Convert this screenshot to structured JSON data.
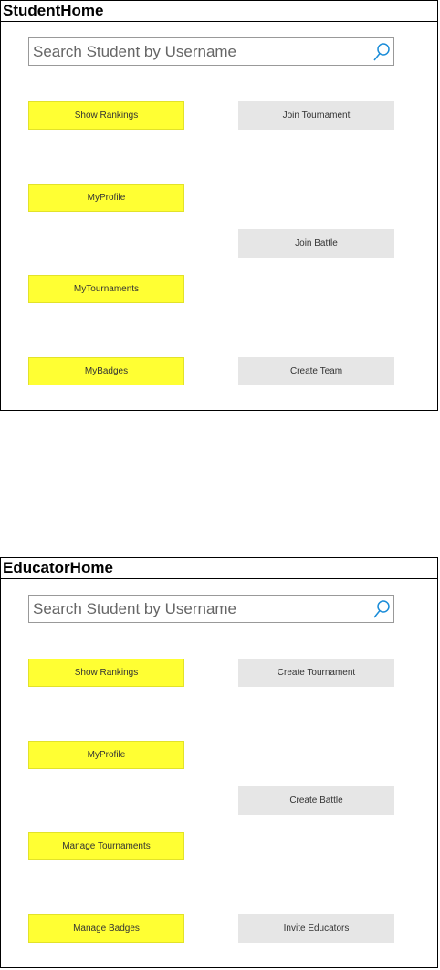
{
  "student_home": {
    "title": "StudentHome",
    "search_placeholder": "Search Student by Username",
    "left_buttons": [
      "Show Rankings",
      "MyProfile",
      "MyTournaments",
      "MyBadges"
    ],
    "right_buttons": [
      "Join Tournament",
      "Join Battle",
      "Create Team"
    ]
  },
  "educator_home": {
    "title": "EducatorHome",
    "search_placeholder": "Search Student by Username",
    "left_buttons": [
      "Show Rankings",
      "MyProfile",
      "Manage Tournaments",
      "Manage Badges"
    ],
    "right_buttons": [
      "Create Tournament",
      "Create Battle",
      "Invite Educators"
    ]
  },
  "colors": {
    "primary_button": "#ffff33",
    "secondary_button": "#e6e6e6",
    "search_icon": "#1a8cd8"
  },
  "icons": {
    "search": "search-icon"
  }
}
